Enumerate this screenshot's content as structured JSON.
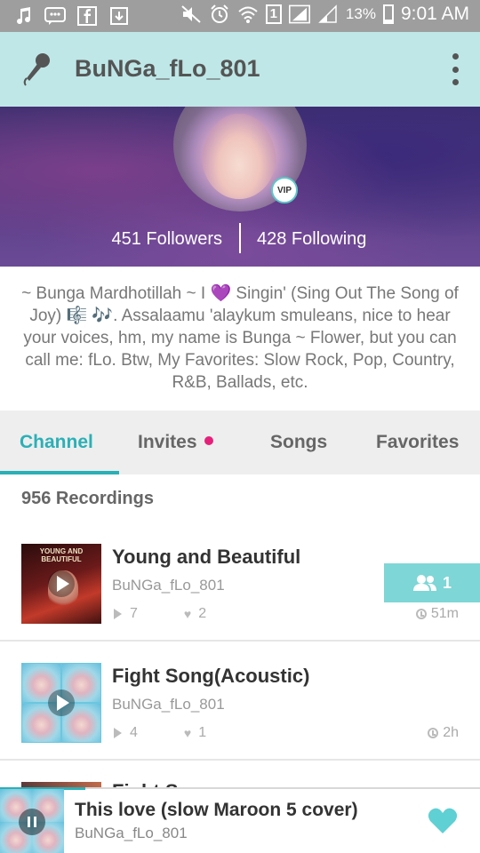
{
  "status_bar": {
    "signal_percent": "13%",
    "sim_label": "1",
    "time": "9:01 AM"
  },
  "app_bar": {
    "title": "BuNGa_fLo_801"
  },
  "profile": {
    "vip_label": "VIP",
    "followers": "451 Followers",
    "following": "428 Following",
    "bio": "~ Bunga Mardhotillah ~ I 💜 Singin' (Sing Out The Song of Joy) 🎼 🎶. Assalaamu 'alaykum smuleans, nice to hear your voices, hm, my name is Bunga ~ Flower, but you can call me: fLo. Btw, My Favorites: Slow Rock, Pop, Country, R&B, Ballads, etc."
  },
  "tabs": [
    {
      "label": "Channel",
      "active": true
    },
    {
      "label": "Invites",
      "active": false
    },
    {
      "label": "Songs",
      "active": false
    },
    {
      "label": "Favorites",
      "active": false
    }
  ],
  "recordings_count": "956 Recordings",
  "songs": [
    {
      "thumb_text": "YOUNG AND BEAUTIFUL",
      "title": "Young and Beautiful",
      "artist": "BuNGa_fLo_801",
      "plays": "7",
      "loves": "2",
      "age": "51m",
      "joiners": "1"
    },
    {
      "title": "Fight Song(Acoustic)",
      "artist": "BuNGa_fLo_801",
      "plays": "4",
      "loves": "1",
      "age": "2h"
    }
  ],
  "partial_song": {
    "title": "Fight S..."
  },
  "player": {
    "title": "This love (slow Maroon 5 cover)",
    "artist": "BuNGa_fLo_801"
  },
  "colors": {
    "accent": "#2ab0b6",
    "app_bar": "#bfe7e7",
    "join_button": "#7ed6d6",
    "invite_dot": "#e6207a"
  }
}
